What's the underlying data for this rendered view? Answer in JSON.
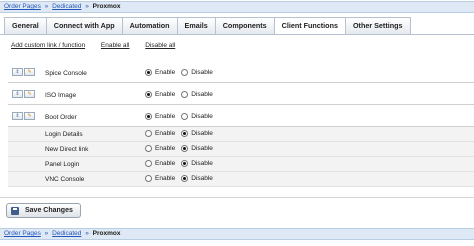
{
  "breadcrumb": {
    "items": [
      "Order Pages",
      "Dedicated"
    ],
    "separator": "»",
    "current": "Proxmox"
  },
  "tabs": [
    {
      "label": "General"
    },
    {
      "label": "Connect with App"
    },
    {
      "label": "Automation"
    },
    {
      "label": "Emails"
    },
    {
      "label": "Components"
    },
    {
      "label": "Client Functions",
      "active": true
    },
    {
      "label": "Other Settings"
    }
  ],
  "actions": {
    "add": "Add custom link / function",
    "enable_all": "Enable all",
    "disable_all": "Disable all"
  },
  "radio_labels": {
    "enable": "Enable",
    "disable": "Disable"
  },
  "functions": [
    {
      "label": "Spice Console",
      "value": "enable"
    },
    {
      "label": "ISO Image",
      "value": "enable"
    },
    {
      "label": "Boot Order",
      "value": "enable"
    },
    {
      "label": "Login Details",
      "value": "disable",
      "child": true
    },
    {
      "label": "New Direct link",
      "value": "disable",
      "child": true
    },
    {
      "label": "Panel Login",
      "value": "disable",
      "child": true
    },
    {
      "label": "VNC Console",
      "value": "disable",
      "child": true
    }
  ],
  "save_label": "Save Changes",
  "icons": {
    "move": "arrows-icon",
    "edit": "pencil-icon",
    "save": "disk-icon"
  }
}
